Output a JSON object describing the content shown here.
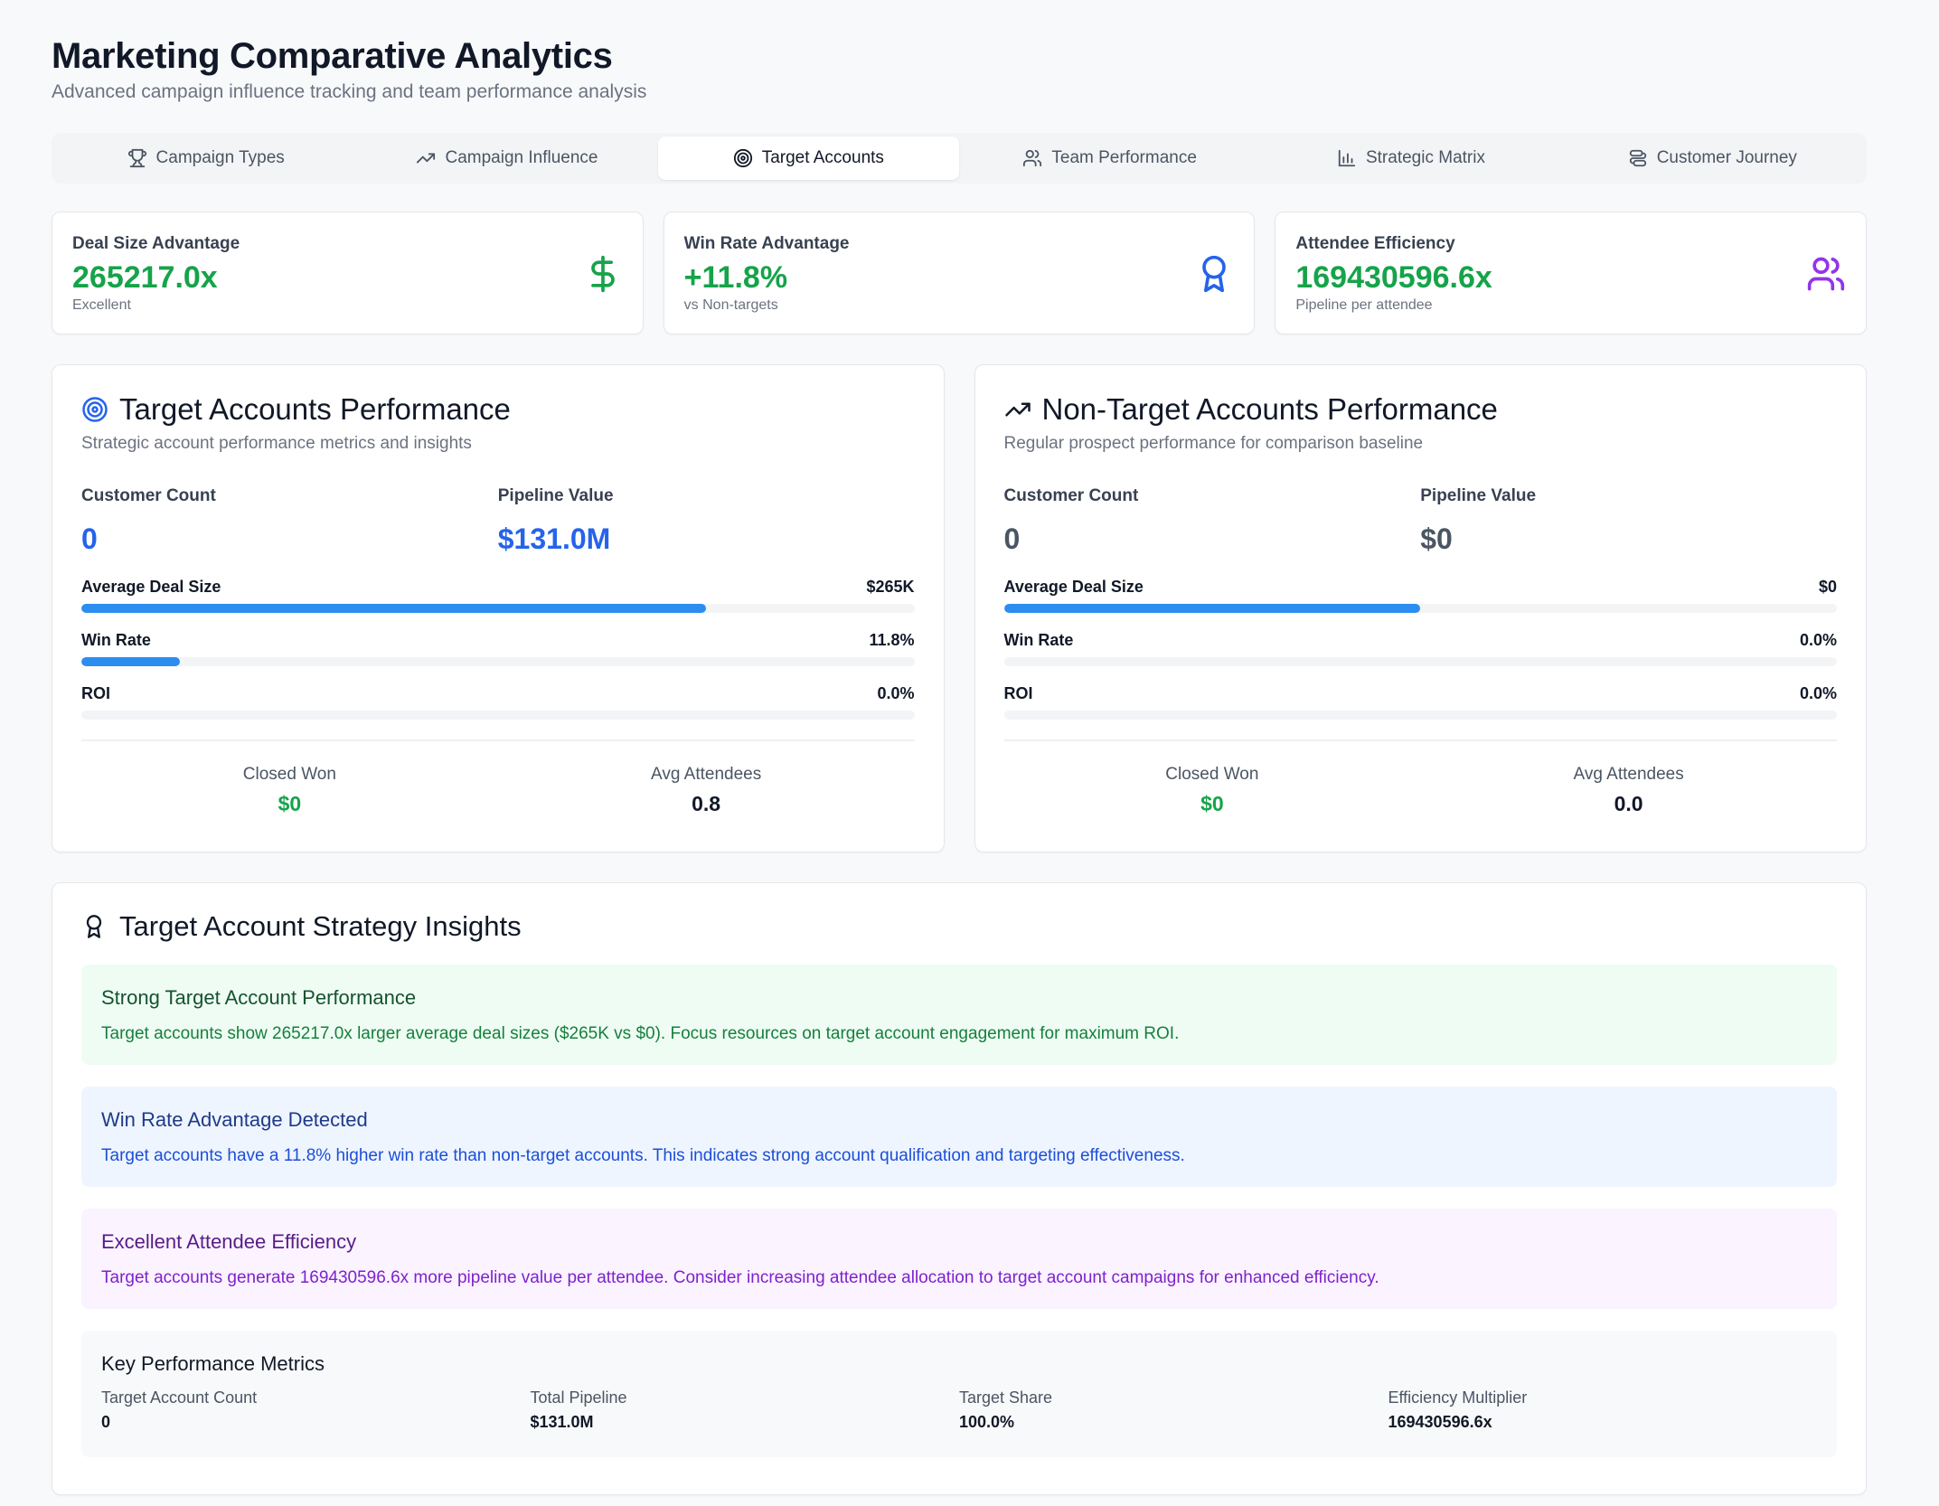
{
  "header": {
    "title": "Marketing Comparative Analytics",
    "subtitle": "Advanced campaign influence tracking and team performance analysis"
  },
  "tabs": [
    {
      "label": "Campaign Types",
      "icon": "trophy-icon"
    },
    {
      "label": "Campaign Influence",
      "icon": "trending-up-icon"
    },
    {
      "label": "Target Accounts",
      "icon": "target-icon",
      "active": true
    },
    {
      "label": "Team Performance",
      "icon": "users-icon"
    },
    {
      "label": "Strategic Matrix",
      "icon": "bar-chart-icon"
    },
    {
      "label": "Customer Journey",
      "icon": "route-icon"
    }
  ],
  "kpis": [
    {
      "label": "Deal Size Advantage",
      "value": "265217.0x",
      "sub": "Excellent",
      "icon": "dollar-icon",
      "icon_color": "#16a34a"
    },
    {
      "label": "Win Rate Advantage",
      "value": "+11.8%",
      "sub": "vs Non-targets",
      "icon": "award-icon",
      "icon_color": "#2563eb"
    },
    {
      "label": "Attendee Efficiency",
      "value": "169430596.6x",
      "sub": "Pipeline per attendee",
      "icon": "users-icon",
      "icon_color": "#9333ea"
    }
  ],
  "target": {
    "title": "Target Accounts Performance",
    "subtitle": "Strategic account performance metrics and insights",
    "customer_count_label": "Customer Count",
    "customer_count": "0",
    "pipeline_label": "Pipeline Value",
    "pipeline": "$131.0M",
    "value_color": "#2563eb",
    "bars": [
      {
        "label": "Average Deal Size",
        "value": "$265K",
        "fill": 0.75
      },
      {
        "label": "Win Rate",
        "value": "11.8%",
        "fill": 0.118
      },
      {
        "label": "ROI",
        "value": "0.0%",
        "fill": 0
      }
    ],
    "closed_won_label": "Closed Won",
    "closed_won": "$0",
    "avg_attendees_label": "Avg Attendees",
    "avg_attendees": "0.8"
  },
  "nontarget": {
    "title": "Non-Target Accounts Performance",
    "subtitle": "Regular prospect performance for comparison baseline",
    "customer_count_label": "Customer Count",
    "customer_count": "0",
    "pipeline_label": "Pipeline Value",
    "pipeline": "$0",
    "value_color": "#4b5563",
    "bars": [
      {
        "label": "Average Deal Size",
        "value": "$0",
        "fill": 0.5
      },
      {
        "label": "Win Rate",
        "value": "0.0%",
        "fill": 0
      },
      {
        "label": "ROI",
        "value": "0.0%",
        "fill": 0
      }
    ],
    "closed_won_label": "Closed Won",
    "closed_won": "$0",
    "avg_attendees_label": "Avg Attendees",
    "avg_attendees": "0.0"
  },
  "insights": {
    "title": "Target Account Strategy Insights",
    "cards": [
      {
        "title": "Strong Target Account Performance",
        "text": "Target accounts show 265217.0x larger average deal sizes ($265K vs $0). Focus resources on target account engagement for maximum ROI."
      },
      {
        "title": "Win Rate Advantage Detected",
        "text": "Target accounts have a 11.8% higher win rate than non-target accounts. This indicates strong account qualification and targeting effectiveness."
      },
      {
        "title": "Excellent Attendee Efficiency",
        "text": "Target accounts generate 169430596.6x more pipeline value per attendee. Consider increasing attendee allocation to target account campaigns for enhanced efficiency."
      }
    ],
    "key_metrics": {
      "title": "Key Performance Metrics",
      "items": [
        {
          "label": "Target Account Count",
          "value": "0"
        },
        {
          "label": "Total Pipeline",
          "value": "$131.0M"
        },
        {
          "label": "Target Share",
          "value": "100.0%"
        },
        {
          "label": "Efficiency Multiplier",
          "value": "169430596.6x"
        }
      ]
    }
  },
  "colors": {
    "green": "#16a34a",
    "blue": "#2563eb",
    "purple": "#9333ea",
    "bar": "#2b8df0"
  }
}
